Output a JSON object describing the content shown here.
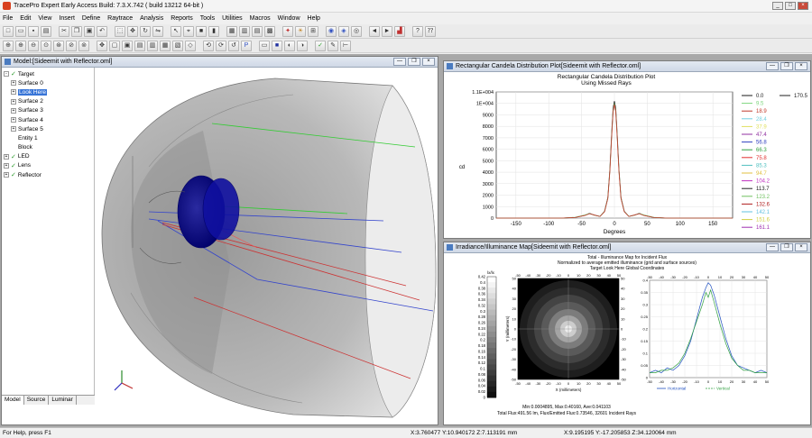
{
  "app": {
    "title": "TracePro Expert   Early Access Build: 7.3.X.742   ( build 13212 64-bit )"
  },
  "menu": [
    "File",
    "Edit",
    "View",
    "Insert",
    "Define",
    "Raytrace",
    "Analysis",
    "Reports",
    "Tools",
    "Utilities",
    "Macros",
    "Window",
    "Help"
  ],
  "model_window": {
    "title": "Model:[Sideemit with Reflector.oml]",
    "tree": [
      {
        "label": "Target",
        "level": 0,
        "exp": "-",
        "check": true
      },
      {
        "label": "Surface 0",
        "level": 1,
        "exp": "+",
        "check": false
      },
      {
        "label": "Look Here",
        "level": 1,
        "exp": "+",
        "check": false,
        "selected": true
      },
      {
        "label": "Surface 2",
        "level": 1,
        "exp": "+",
        "check": false
      },
      {
        "label": "Surface 3",
        "level": 1,
        "exp": "+",
        "check": false
      },
      {
        "label": "Surface 4",
        "level": 1,
        "exp": "+",
        "check": false
      },
      {
        "label": "Surface 5",
        "level": 1,
        "exp": "+",
        "check": false
      },
      {
        "label": "Entity 1",
        "level": 1,
        "exp": "",
        "check": false
      },
      {
        "label": "Block",
        "level": 1,
        "exp": "",
        "check": false
      },
      {
        "label": "LED",
        "level": 0,
        "exp": "+",
        "check": true
      },
      {
        "label": "Lens",
        "level": 0,
        "exp": "+",
        "check": true
      },
      {
        "label": "Reflector",
        "level": 0,
        "exp": "+",
        "check": true
      }
    ],
    "tabs": [
      "Model",
      "Source",
      "Luminar"
    ]
  },
  "candela_window": {
    "title": "Rectangular Candela Distribution Plot[Sideemit with Reflector.oml]"
  },
  "irradiance_window": {
    "title": "Irradiance/Illuminance Map[Sideemit with Reflector.oml]",
    "heading": "Total - Illuminance Map for Incident Flux",
    "subheading": "Normalized to average emitted illuminance (grid and surface sources)",
    "target_line": "Target Look Here      Global Coordinates",
    "colorbar_unit": "lx/lx",
    "colorbar_ticks": [
      "0.42",
      "0.4",
      "0.38",
      "0.36",
      "0.34",
      "0.32",
      "0.3",
      "0.28",
      "0.26",
      "0.24",
      "0.22",
      "0.2",
      "0.18",
      "0.16",
      "0.14",
      "0.12",
      "0.1",
      "0.08",
      "0.06",
      "0.04",
      "0.02",
      "0"
    ],
    "map_xlabel": "X (millimeters)",
    "map_ylabel": "Y (millimeters)",
    "map_ticks": [
      "-50",
      "-40",
      "-30",
      "-20",
      "-10",
      "0",
      "10",
      "20",
      "30",
      "40",
      "50"
    ],
    "stats1": "Min:0.0004895, Max:0.40160, Ave:0.041103",
    "stats2": "Total Flux:491.56 lm, Flux/Emitted Flux:0.73546, 32601 Incident Rays",
    "profile_yticks": [
      "0.4",
      "0.35",
      "0.3",
      "0.25",
      "0.2",
      "0.15",
      "0.1",
      "0.05",
      "0"
    ],
    "legend_h": "Horizontal",
    "legend_v": "Vertical"
  },
  "status": {
    "help": "For Help, press F1",
    "coord1": "X:3.760477 Y:10.940172 Z:7.113191 mm",
    "coord2": "X:9.195195 Y:-17.205853 Z:34.120064 mm"
  },
  "chart_data": [
    {
      "type": "line",
      "title": "Rectangular Candela Distribution Plot",
      "subtitle": "Using Missed Rays",
      "xlabel": "Degrees",
      "ylabel": "cd",
      "xlim": [
        -180,
        180
      ],
      "ylim": [
        0,
        11000
      ],
      "x_ticks": [
        -150,
        -100,
        -50,
        0,
        50,
        100,
        150
      ],
      "y_ticks": [
        "1.1E+004",
        "1E+004",
        "9000",
        "8000",
        "7000",
        "6000",
        "5000",
        "4000",
        "3000",
        "2000",
        "1000",
        "0"
      ],
      "x": [
        -180,
        -80,
        -60,
        -45,
        -38,
        -30,
        -22,
        -15,
        -10,
        -7,
        -4,
        -2,
        0,
        2,
        4,
        7,
        10,
        15,
        22,
        30,
        38,
        45,
        60,
        80,
        180
      ],
      "series": [
        {
          "name": "0.0",
          "color": "#1a1a1a",
          "values": [
            0,
            0,
            60,
            250,
            420,
            250,
            150,
            600,
            1800,
            4200,
            7600,
            9600,
            10200,
            9600,
            7600,
            4200,
            1800,
            600,
            150,
            250,
            420,
            250,
            60,
            0,
            0
          ]
        },
        {
          "name": "9.5",
          "color": "#7ed67e",
          "values": [
            0,
            0,
            70,
            270,
            400,
            240,
            160,
            580,
            1750,
            4100,
            7400,
            9400,
            10000,
            9400,
            7400,
            4100,
            1750,
            580,
            160,
            240,
            400,
            270,
            70,
            0,
            0
          ]
        },
        {
          "name": "18.9",
          "color": "#c0392b",
          "values": [
            0,
            0,
            50,
            230,
            380,
            260,
            140,
            560,
            1700,
            4000,
            7300,
            9300,
            9900,
            9300,
            7300,
            4000,
            1700,
            560,
            140,
            260,
            380,
            230,
            50,
            0,
            0
          ]
        },
        {
          "name": "28.4",
          "color": "#70d0e0"
        },
        {
          "name": "37.9",
          "color": "#e0e060"
        },
        {
          "name": "47.4",
          "color": "#9030a0"
        },
        {
          "name": "56.8",
          "color": "#3040c0"
        },
        {
          "name": "66.3",
          "color": "#30a040"
        },
        {
          "name": "75.8",
          "color": "#e03030"
        },
        {
          "name": "85.3",
          "color": "#50c0c0"
        },
        {
          "name": "94.7",
          "color": "#e0c040"
        },
        {
          "name": "104.2",
          "color": "#c030c0"
        },
        {
          "name": "113.7",
          "color": "#202020"
        },
        {
          "name": "123.2",
          "color": "#70c060"
        },
        {
          "name": "132.6",
          "color": "#b02020"
        },
        {
          "name": "142.1",
          "color": "#60c0e0"
        },
        {
          "name": "151.6",
          "color": "#d0d040"
        },
        {
          "name": "161.1",
          "color": "#a030b0"
        },
        {
          "name": "170.5",
          "color": "#202020"
        }
      ]
    },
    {
      "type": "line",
      "title": "",
      "xlim": [
        -50,
        50
      ],
      "ylim": [
        0,
        0.4
      ],
      "x_ticks": [
        -50,
        -40,
        -30,
        -20,
        -10,
        0,
        10,
        20,
        30,
        40,
        50
      ],
      "x": [
        -50,
        -45,
        -40,
        -35,
        -30,
        -25,
        -20,
        -15,
        -10,
        -5,
        -2,
        0,
        2,
        5,
        10,
        15,
        20,
        25,
        30,
        35,
        40,
        45,
        50
      ],
      "series": [
        {
          "name": "Horizontal",
          "color": "#2050c0",
          "values": [
            0.02,
            0.03,
            0.02,
            0.04,
            0.03,
            0.05,
            0.09,
            0.15,
            0.24,
            0.33,
            0.37,
            0.39,
            0.38,
            0.34,
            0.25,
            0.16,
            0.09,
            0.05,
            0.04,
            0.03,
            0.02,
            0.03,
            0.02
          ]
        },
        {
          "name": "Vertical",
          "color": "#30a040",
          "values": [
            0.02,
            0.02,
            0.03,
            0.03,
            0.04,
            0.06,
            0.1,
            0.16,
            0.23,
            0.3,
            0.35,
            0.33,
            0.36,
            0.31,
            0.22,
            0.14,
            0.08,
            0.05,
            0.03,
            0.03,
            0.02,
            0.02,
            0.02
          ]
        }
      ]
    }
  ]
}
